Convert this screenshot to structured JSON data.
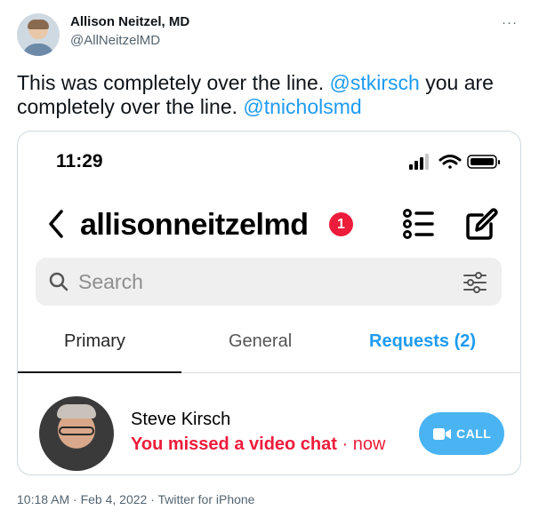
{
  "author": {
    "name": "Allison Neitzel, MD",
    "handle": "@AllNeitzelMD"
  },
  "tweet": {
    "text_part1": "This was completely over the line. ",
    "mention1": "@stkirsch",
    "text_part2": " you are completely over the line. ",
    "mention2": "@tnicholsmd"
  },
  "more_label": "···",
  "phone": {
    "status_time": "11:29",
    "username": "allisonneitzelmd",
    "badge_count": "1",
    "search_placeholder": "Search",
    "tabs": {
      "primary": "Primary",
      "general": "General",
      "requests": "Requests (2)"
    },
    "dm": {
      "name": "Steve Kirsch",
      "message": "You missed a video chat",
      "separator": " · ",
      "time": "now",
      "call_label": "CALL"
    },
    "colors": {
      "badge": "#ed1c3b",
      "accent": "#1d9bf0",
      "call_button": "#4ab4f2"
    }
  },
  "meta": {
    "timestamp": "10:18 AM · Feb 4, 2022",
    "separator": " · ",
    "source": "Twitter for iPhone"
  }
}
